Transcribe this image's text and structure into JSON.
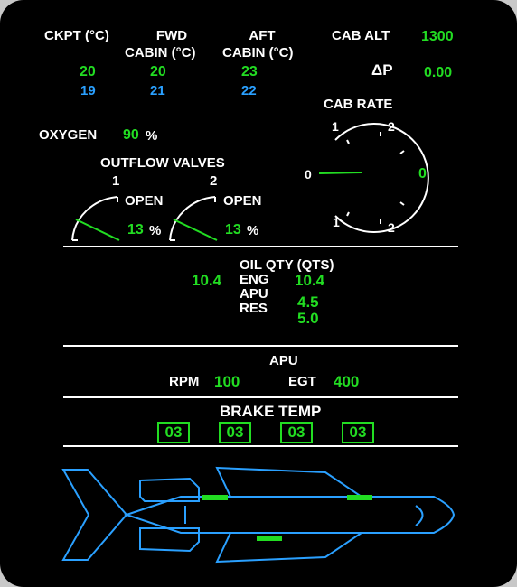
{
  "temps": {
    "ckpt": {
      "label": "CKPT (°C)",
      "actual": "20",
      "target": "19"
    },
    "fwd": {
      "label1": "FWD",
      "label2": "CABIN (°C)",
      "actual": "20",
      "target": "21"
    },
    "aft": {
      "label1": "AFT",
      "label2": "CABIN (°C)",
      "actual": "23",
      "target": "22"
    }
  },
  "cab_alt": {
    "label": "CAB ALT",
    "value": "1300"
  },
  "delta_p": {
    "label": "ΔP",
    "value": "0.00"
  },
  "cab_rate": {
    "label": "CAB RATE",
    "value": "0",
    "marks": [
      "1",
      "2",
      "0",
      "1",
      "2"
    ],
    "needle_value": 0
  },
  "oxygen": {
    "label": "OXYGEN",
    "value": "90",
    "unit": "%"
  },
  "outflow": {
    "title": "OUTFLOW VALVES",
    "valves": [
      {
        "num": "1",
        "state": "OPEN",
        "value": "13",
        "unit": "%"
      },
      {
        "num": "2",
        "state": "OPEN",
        "value": "13",
        "unit": "%"
      }
    ]
  },
  "oil": {
    "title": "OIL QTY (QTS)",
    "left_value": "10.4",
    "eng_label": "ENG",
    "eng_value": "10.4",
    "apu_label": "APU",
    "apu_value": "4.5",
    "res_label": "RES",
    "res_value": "5.0"
  },
  "apu": {
    "title": "APU",
    "rpm_label": "RPM",
    "rpm_value": "100",
    "egt_label": "EGT",
    "egt_value": "400"
  },
  "brake": {
    "title": "BRAKE TEMP",
    "values": [
      "03",
      "03",
      "03",
      "03"
    ]
  },
  "colors": {
    "background": "#000000",
    "label": "#ffffff",
    "value_green": "#22dd22",
    "target_cyan": "#2aa0ff",
    "outline": "#2aa0ff"
  }
}
